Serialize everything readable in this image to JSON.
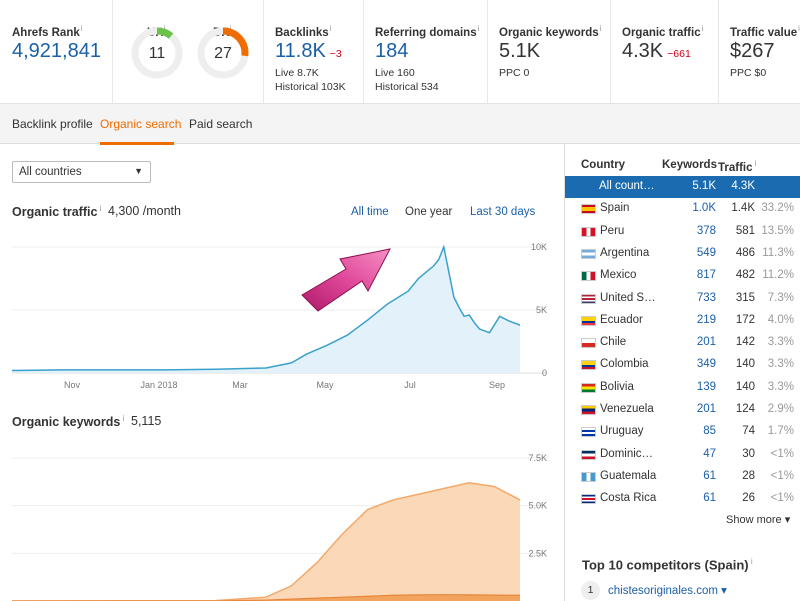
{
  "metrics": {
    "ahrefs_rank": {
      "label": "Ahrefs Rank",
      "value": "4,921,841"
    },
    "ur": {
      "label": "UR",
      "value": "11",
      "level": 11,
      "color": "#6cc24a"
    },
    "dr": {
      "label": "DR",
      "value": "27",
      "level": 27,
      "color": "#ef6c00"
    },
    "backlinks": {
      "label": "Backlinks",
      "value": "11.8K",
      "delta": "−3",
      "live": "Live 8.7K",
      "historical": "Historical 103K"
    },
    "referring_domains": {
      "label": "Referring domains",
      "value": "184",
      "live": "Live 160",
      "historical": "Historical 534"
    },
    "organic_keywords": {
      "label": "Organic keywords",
      "value": "5.1K",
      "ppc": "PPC 0"
    },
    "organic_traffic": {
      "label": "Organic traffic",
      "value": "4.3K",
      "delta": "−661"
    },
    "traffic_value": {
      "label": "Traffic value",
      "value": "$267",
      "ppc": "PPC $0"
    }
  },
  "tabs": [
    "Backlink profile",
    "Organic search",
    "Paid search"
  ],
  "active_tab": "Organic search",
  "country_select": "All countries",
  "traffic_section": {
    "title": "Organic traffic",
    "value": "4,300 /month",
    "ranges": [
      "All time",
      "One year",
      "Last 30 days"
    ],
    "active_range": "One year"
  },
  "keywords_section": {
    "title": "Organic keywords",
    "value": "5,115"
  },
  "chart_data": [
    {
      "type": "area",
      "title": "Organic traffic",
      "x_ticks": [
        "Nov",
        "Jan 2018",
        "Mar",
        "May",
        "Jul",
        "Sep"
      ],
      "y_ticks": [
        "10K",
        "5K",
        "0"
      ],
      "ylim": [
        0,
        10000
      ],
      "color": "#3aa0cc",
      "x": [
        0,
        10,
        20,
        30,
        40,
        50,
        55,
        58,
        62,
        66,
        70,
        74,
        78,
        80,
        83,
        84,
        85,
        86,
        87,
        88,
        89,
        90,
        91,
        92,
        94,
        96,
        98,
        100
      ],
      "values": [
        200,
        250,
        250,
        250,
        300,
        400,
        800,
        1500,
        2200,
        3000,
        4200,
        5500,
        6500,
        7500,
        8500,
        9000,
        10000,
        8000,
        6000,
        5200,
        4500,
        4600,
        4000,
        3500,
        3200,
        4500,
        4100,
        3800
      ]
    },
    {
      "type": "area",
      "title": "Organic keywords",
      "y_ticks": [
        "7.5K",
        "5.0K",
        "2.5K"
      ],
      "ylim": [
        0,
        7500
      ],
      "color": "#f3a868",
      "x": [
        0,
        40,
        50,
        55,
        60,
        65,
        70,
        75,
        80,
        85,
        90,
        95,
        100
      ],
      "series": [
        {
          "values": [
            0,
            20,
            200,
            800,
            2000,
            3500,
            4800,
            5300,
            5600,
            5900,
            6200,
            6000,
            5300
          ]
        },
        {
          "values": [
            0,
            0,
            50,
            100,
            150,
            200,
            250,
            300,
            320,
            330,
            320,
            310,
            300
          ]
        }
      ]
    }
  ],
  "country_table": {
    "headers": [
      "Country",
      "Keywords",
      "Traffic"
    ],
    "rows": [
      {
        "country": "All count…",
        "keywords": "5.1K",
        "traffic": "4.3K",
        "pct": "",
        "selected": true
      },
      {
        "country": "Spain",
        "keywords": "1.0K",
        "traffic": "1.4K",
        "pct": "33.2%"
      },
      {
        "country": "Peru",
        "keywords": "378",
        "traffic": "581",
        "pct": "13.5%"
      },
      {
        "country": "Argentina",
        "keywords": "549",
        "traffic": "486",
        "pct": "11.3%"
      },
      {
        "country": "Mexico",
        "keywords": "817",
        "traffic": "482",
        "pct": "11.2%"
      },
      {
        "country": "United S…",
        "keywords": "733",
        "traffic": "315",
        "pct": "7.3%"
      },
      {
        "country": "Ecuador",
        "keywords": "219",
        "traffic": "172",
        "pct": "4.0%"
      },
      {
        "country": "Chile",
        "keywords": "201",
        "traffic": "142",
        "pct": "3.3%"
      },
      {
        "country": "Colombia",
        "keywords": "349",
        "traffic": "140",
        "pct": "3.3%"
      },
      {
        "country": "Bolivia",
        "keywords": "139",
        "traffic": "140",
        "pct": "3.3%"
      },
      {
        "country": "Venezuela",
        "keywords": "201",
        "traffic": "124",
        "pct": "2.9%"
      },
      {
        "country": "Uruguay",
        "keywords": "85",
        "traffic": "74",
        "pct": "1.7%"
      },
      {
        "country": "Dominic…",
        "keywords": "47",
        "traffic": "30",
        "pct": "<1%"
      },
      {
        "country": "Guatemala",
        "keywords": "61",
        "traffic": "28",
        "pct": "<1%"
      },
      {
        "country": "Costa Rica",
        "keywords": "61",
        "traffic": "26",
        "pct": "<1%"
      }
    ],
    "show_more": "Show more ▾"
  },
  "competitors": {
    "title": "Top 10 competitors (Spain)",
    "first_rank": "1",
    "first_site": "chistesoriginales.com ▾"
  }
}
